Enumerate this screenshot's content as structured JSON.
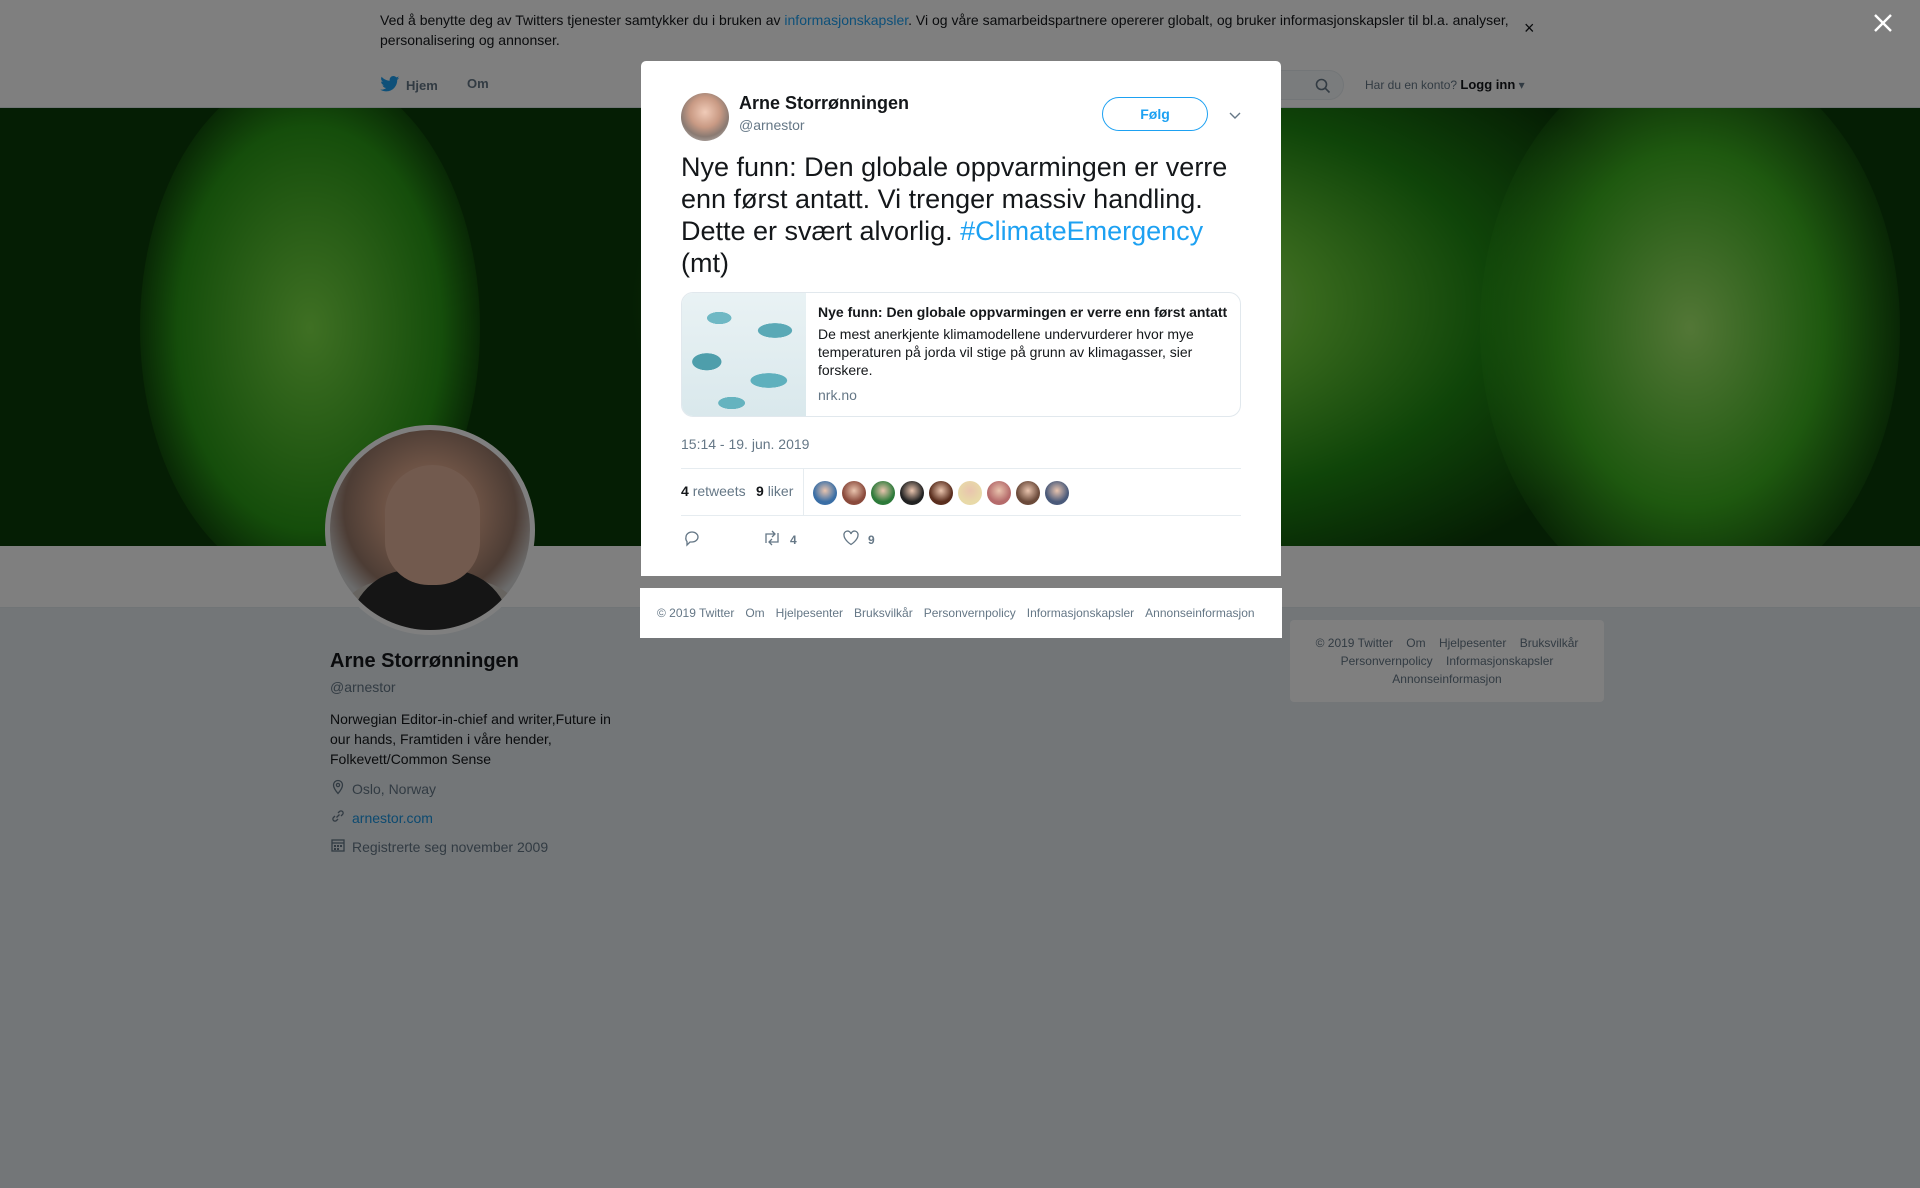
{
  "cookie": {
    "text_before": "Ved å benytte deg av Twitters tjenester samtykker du i bruken av ",
    "link": "informasjonskapsler",
    "text_after": ". Vi og våre samarbeidspartnere opererer globalt, og bruker informasjonskapsler til bl.a. analyser, personalisering og annonser.",
    "close": "×"
  },
  "nav": {
    "home": "Hjem",
    "about": "Om",
    "login_prompt": "Har du en konto?",
    "login": "Logg inn"
  },
  "profile": {
    "name": "Arne Storrønningen",
    "handle": "@arnestor",
    "bio": "Norwegian Editor-in-chief and writer,Future in our hands, Framtiden i våre hender, Folkevett/Common Sense",
    "location": "Oslo, Norway",
    "website": "arnestor.com",
    "joined": "Registrerte seg november 2009"
  },
  "side_footer": {
    "items": [
      "© 2019 Twitter",
      "Om",
      "Hjelpesenter",
      "Bruksvilkår",
      "Personvernpolicy",
      "Informasjonskapsler",
      "Annonseinformasjon"
    ]
  },
  "tweet": {
    "author_name": "Arne Storrønningen",
    "author_handle": "@arnestor",
    "follow_label": "Følg",
    "text": "Nye funn: Den globale oppvarmingen er verre enn først antatt. Vi trenger massiv handling. Dette er svært alvorlig. ",
    "hashtag": "#ClimateEmergency",
    "text_end": " (mt)",
    "card": {
      "title": "Nye funn: Den globale oppvarmingen er verre enn først antatt",
      "description": "De mest anerkjente klimamodellene undervurderer hvor mye temperaturen på jorda vil stige på grunn av klimagasser, sier forskere.",
      "domain": "nrk.no"
    },
    "timestamp": "15:14 - 19. jun. 2019",
    "retweets_count": "4",
    "retweets_label": "retweets",
    "likes_count": "9",
    "likes_label": "liker",
    "liker_colors": [
      "#3a6ea5",
      "#8a4a3c",
      "#2d7a3a",
      "#222222",
      "#5a2e1e",
      "#e8d9a8",
      "#b56b6b",
      "#6b4a3a",
      "#4a5a7a"
    ],
    "action_retweets": "4",
    "action_likes": "9"
  },
  "modal_footer": {
    "items": [
      "© 2019 Twitter",
      "Om",
      "Hjelpesenter",
      "Bruksvilkår",
      "Personvernpolicy",
      "Informasjonskapsler",
      "Annonseinformasjon"
    ]
  },
  "colors": {
    "accent": "#1da1f2",
    "overlay": "rgba(0,0,0,0.5)"
  }
}
